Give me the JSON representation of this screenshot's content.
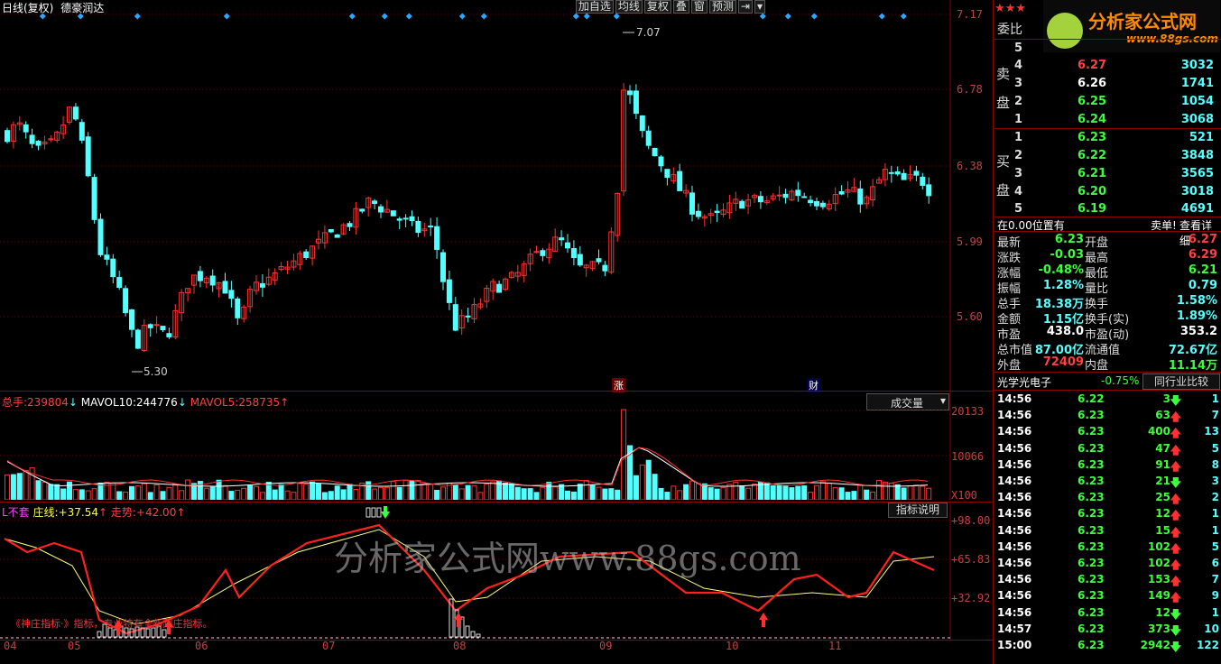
{
  "header": {
    "title": "日线(复权)",
    "stock_name": "德豪润达",
    "toolbar": [
      "加自选",
      "均线",
      "复权",
      "叠",
      "窗",
      "预测"
    ]
  },
  "logo": {
    "text": "分析家公式网",
    "url": "www.88gs.com"
  },
  "price_axis": [
    "7.17",
    "6.78",
    "6.38",
    "5.99",
    "5.60"
  ],
  "price_marks": {
    "high": "7.07",
    "low": "5.30",
    "zhang_label": "涨",
    "cai_label": "财"
  },
  "volume": {
    "total_label": "总手:",
    "total_value": "239804",
    "ma10_label": "MAVOL10:",
    "ma10_value": "244776",
    "ma5_label": "MAVOL5:",
    "ma5_value": "258735",
    "dropdown": "成交量",
    "axis": [
      "20133",
      "10066"
    ],
    "unit": "X100"
  },
  "indicator": {
    "name": "L不套",
    "line1_label": "庄线:",
    "line1_value": "+37.54",
    "line2_label": "走势:",
    "line2_value": "+42.00",
    "help_button": "指标说明",
    "axis": [
      "+98.00",
      "+65.83",
      "+32.92"
    ],
    "note": "《神庄指标·》指标，专业特有全新跟庄指标。",
    "watermark": "分析家公式网www.88gs.com"
  },
  "x_axis": [
    "04",
    "05",
    "06",
    "07",
    "08",
    "09",
    "10",
    "11"
  ],
  "order_book": {
    "title": "委比",
    "sell_label": [
      "卖",
      "盘"
    ],
    "buy_label": [
      "买",
      "盘"
    ],
    "asks": [
      {
        "level": "5",
        "price": "",
        "volume": ""
      },
      {
        "level": "4",
        "price": "6.27",
        "volume": "3032"
      },
      {
        "level": "3",
        "price": "6.26",
        "volume": "1741"
      },
      {
        "level": "2",
        "price": "6.25",
        "volume": "1054"
      },
      {
        "level": "1",
        "price": "6.24",
        "volume": "3068"
      }
    ],
    "bids": [
      {
        "level": "1",
        "price": "6.23",
        "volume": "521"
      },
      {
        "level": "2",
        "price": "6.22",
        "volume": "3848"
      },
      {
        "level": "3",
        "price": "6.21",
        "volume": "3565"
      },
      {
        "level": "4",
        "price": "6.20",
        "volume": "3018"
      },
      {
        "level": "5",
        "price": "6.19",
        "volume": "4691"
      }
    ],
    "position_text": "在0.00位置有",
    "sell_single": "卖单!",
    "detail_link": "查看详细"
  },
  "quote": [
    {
      "l1": "最新",
      "v1": "6.23",
      "c1": "green",
      "l2": "开盘",
      "v2": "6.27",
      "c2": "red"
    },
    {
      "l1": "涨跌",
      "v1": "-0.03",
      "c1": "green",
      "l2": "最高",
      "v2": "6.29",
      "c2": "red"
    },
    {
      "l1": "涨幅",
      "v1": "-0.48%",
      "c1": "green",
      "l2": "最低",
      "v2": "6.21",
      "c2": "green"
    },
    {
      "l1": "振幅",
      "v1": "1.28%",
      "c1": "cyan",
      "l2": "量比",
      "v2": "0.79",
      "c2": "cyan"
    },
    {
      "l1": "总手",
      "v1": "18.38万",
      "c1": "cyan",
      "l2": "换手",
      "v2": "1.58%",
      "c2": "cyan"
    },
    {
      "l1": "金额",
      "v1": "1.15亿",
      "c1": "cyan",
      "l2": "换手(实)",
      "v2": "1.89%",
      "c2": "cyan"
    },
    {
      "l1": "市盈",
      "v1": "438.0",
      "c1": "white",
      "l2": "市盈(动)",
      "v2": "353.2",
      "c2": "white"
    },
    {
      "l1": "总市值",
      "v1": "87.00亿",
      "c1": "cyan",
      "l2": "流通值",
      "v2": "72.67亿",
      "c2": "cyan"
    },
    {
      "l1": "外盘",
      "v1": "72409",
      "c1": "red",
      "l2": "内盘",
      "v2": "11.14万",
      "c2": "green"
    }
  ],
  "industry": {
    "name": "光学光电子",
    "change": "-0.75%",
    "compare_button": "同行业比较"
  },
  "ticks": [
    {
      "time": "14:56",
      "price": "6.22",
      "vol": "3",
      "dir": "down",
      "count": "1"
    },
    {
      "time": "14:56",
      "price": "6.23",
      "vol": "63",
      "dir": "up",
      "count": "7"
    },
    {
      "time": "14:56",
      "price": "6.23",
      "vol": "400",
      "dir": "up",
      "count": "13"
    },
    {
      "time": "14:56",
      "price": "6.23",
      "vol": "47",
      "dir": "up",
      "count": "5"
    },
    {
      "time": "14:56",
      "price": "6.23",
      "vol": "91",
      "dir": "up",
      "count": "8"
    },
    {
      "time": "14:56",
      "price": "6.23",
      "vol": "21",
      "dir": "down",
      "count": "3"
    },
    {
      "time": "14:56",
      "price": "6.23",
      "vol": "25",
      "dir": "up",
      "count": "2"
    },
    {
      "time": "14:56",
      "price": "6.23",
      "vol": "12",
      "dir": "up",
      "count": "1"
    },
    {
      "time": "14:56",
      "price": "6.23",
      "vol": "15",
      "dir": "up",
      "count": "1"
    },
    {
      "time": "14:56",
      "price": "6.23",
      "vol": "102",
      "dir": "up",
      "count": "5"
    },
    {
      "time": "14:56",
      "price": "6.23",
      "vol": "102",
      "dir": "up",
      "count": "6"
    },
    {
      "time": "14:56",
      "price": "6.23",
      "vol": "153",
      "dir": "up",
      "count": "7"
    },
    {
      "time": "14:56",
      "price": "6.23",
      "vol": "149",
      "dir": "up",
      "count": "9"
    },
    {
      "time": "14:56",
      "price": "6.23",
      "vol": "12",
      "dir": "down",
      "count": "1"
    },
    {
      "time": "14:57",
      "price": "6.23",
      "vol": "373",
      "dir": "down",
      "count": "10"
    },
    {
      "time": "15:00",
      "price": "6.23",
      "vol": "2942",
      "dir": "down",
      "count": "122"
    }
  ],
  "colors": {
    "up": "#ff3232",
    "down": "#54ffff",
    "ma10": "#ffffff",
    "ma5": "#ff3232",
    "zhuang": "#ffff80",
    "zoushi": "#ff2020",
    "grid": "#8b0000"
  }
}
